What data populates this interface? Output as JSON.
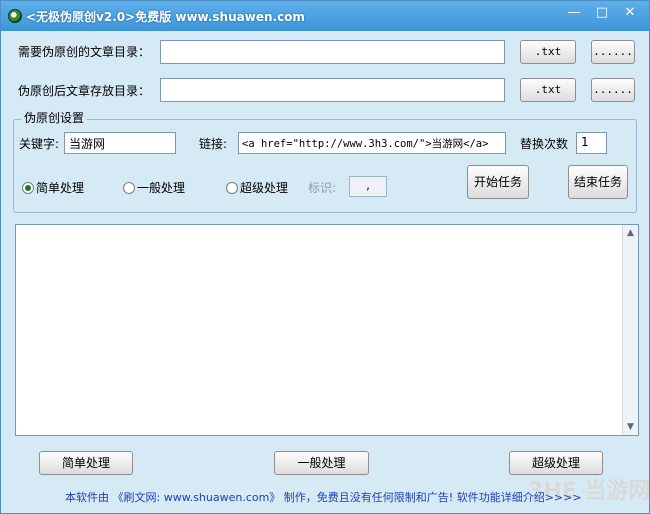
{
  "window": {
    "title": "<无极伪原创v2.0>免费版 www.shuawen.com",
    "min_label": "—",
    "max_label": "□",
    "close_label": "✕"
  },
  "source_dir": {
    "label": "需要伪原创的文章目录：",
    "value": "",
    "ext": ".txt",
    "browse": "......"
  },
  "output_dir": {
    "label": "伪原创后文章存放目录：",
    "value": "",
    "ext": ".txt",
    "browse": "......"
  },
  "settings": {
    "title": "伪原创设置",
    "keyword_label": "关键字:",
    "keyword_value": "当游网",
    "link_label": "链接:",
    "link_value": "<a href=\"http://www.3h3.com/\">当游网</a>",
    "replace_label": "替换次数",
    "replace_value": "1",
    "modes": [
      {
        "label": "简单处理",
        "checked": true
      },
      {
        "label": "一般处理",
        "checked": false
      },
      {
        "label": "超级处理",
        "checked": false
      }
    ],
    "mark_label": "标识:",
    "mark_value": ",",
    "start_button": "开始任务",
    "end_button": "结束任务"
  },
  "log": {
    "content": ""
  },
  "bottom_buttons": {
    "simple": "简单处理",
    "normal": "一般处理",
    "super": "超级处理"
  },
  "footer": "本软件由 《刷文网: www.shuawen.com》 制作，免费且没有任何限制和广告! 软件功能详细介绍>>>>",
  "watermark": "3HE 当游网",
  "colors": {
    "title_bar": "#3d95d9",
    "window_bg": "#d6eaf6",
    "footer_text": "#1c3fb4"
  }
}
